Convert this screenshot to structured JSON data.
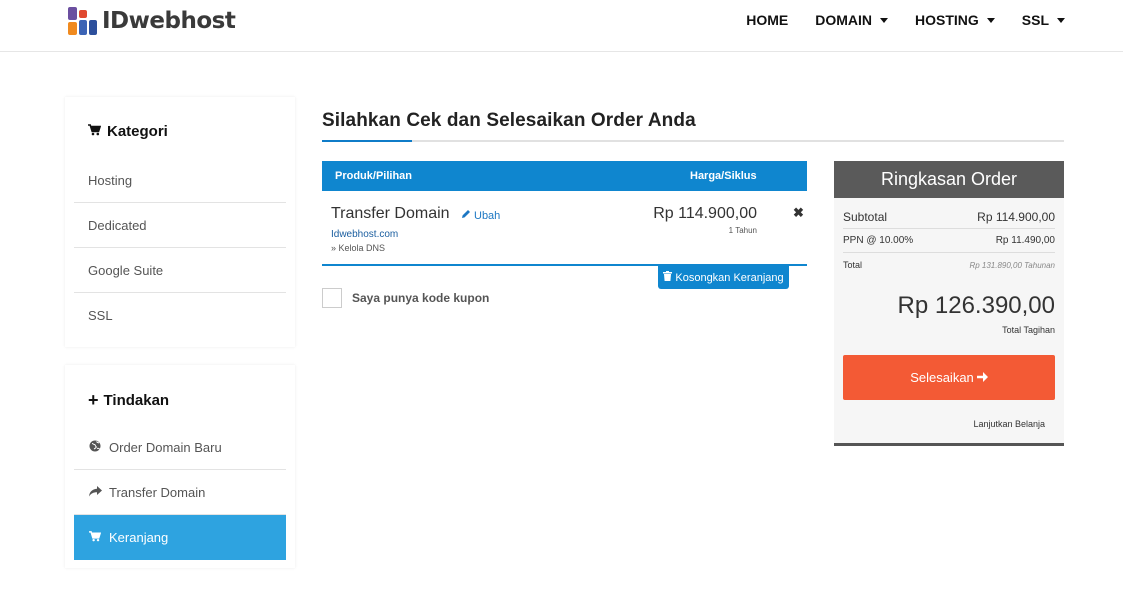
{
  "brand": {
    "name": "IDwebhost"
  },
  "nav": {
    "items": [
      {
        "label": "HOME",
        "dropdown": false
      },
      {
        "label": "DOMAIN",
        "dropdown": true
      },
      {
        "label": "HOSTING",
        "dropdown": true
      },
      {
        "label": "SSL",
        "dropdown": true
      }
    ]
  },
  "sidebar": {
    "categories": {
      "title": "Kategori",
      "icon": "cart-icon",
      "items": [
        "Hosting",
        "Dedicated",
        "Google Suite",
        "SSL"
      ]
    },
    "actions": {
      "title": "Tindakan",
      "icon": "plus-icon",
      "items": [
        {
          "label": "Order Domain Baru",
          "icon": "globe-icon",
          "active": false
        },
        {
          "label": "Transfer Domain",
          "icon": "share-arrow-icon",
          "active": false
        },
        {
          "label": "Keranjang",
          "icon": "cart-icon",
          "active": true
        }
      ]
    }
  },
  "main": {
    "title": "Silahkan Cek dan Selesaikan Order Anda",
    "accent_color": "#0f86cf",
    "cart": {
      "col_product": "Produk/Pilihan",
      "col_price": "Harga/Siklus",
      "item": {
        "name": "Transfer Domain",
        "edit_label": "Ubah",
        "domain": "Idwebhost.com",
        "addon": "» Kelola DNS",
        "price": "Rp 114.900,00",
        "cycle": "1 Tahun",
        "remove": "✖"
      },
      "empty_label": "Kosongkan Keranjang",
      "coupon_label": "Saya punya kode kupon"
    }
  },
  "summary": {
    "title": "Ringkasan Order",
    "subtotal_label": "Subtotal",
    "subtotal_value": "Rp 114.900,00",
    "tax_label": "PPN @ 10.00%",
    "tax_value": "Rp 11.490,00",
    "total_label": "Total",
    "total_annual": "Rp 131.890,00 Tahunan",
    "total_amount": "Rp 126.390,00",
    "total_caption": "Total Tagihan",
    "checkout_label": "Selesaikan",
    "checkout_color": "#f35a35",
    "continue_label": "Lanjutkan Belanja"
  }
}
